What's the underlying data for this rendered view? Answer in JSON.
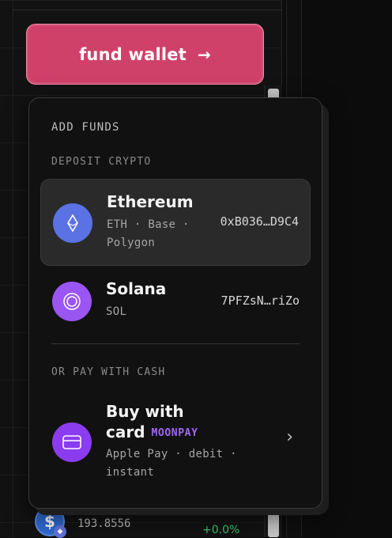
{
  "header": {
    "fund_button_label": "fund wallet",
    "fund_button_arrow": "→"
  },
  "background": {
    "coin_symbol": "$",
    "balance": "193.8556",
    "change": "+0.0%"
  },
  "popover": {
    "title": "ADD FUNDS",
    "deposit_section": "DEPOSIT CRYPTO",
    "options": [
      {
        "name": "Ethereum",
        "networks": "ETH · Base · Polygon",
        "networks_line1": "ETH · Base ·",
        "networks_line2": "Polygon",
        "address": "0xB036…D9C4",
        "icon": "ethereum-icon",
        "color": "#5b72e4"
      },
      {
        "name": "Solana",
        "networks": "SOL",
        "address": "7PFZsN…riZo",
        "icon": "solana-icon",
        "color": "#9a55f3"
      }
    ],
    "cash_section": "OR PAY WITH CASH",
    "cash_option": {
      "name_line1": "Buy with",
      "name_line2": "card",
      "provider": "MOONPAY",
      "methods_line1": "Apple Pay · debit ·",
      "methods_line2": "instant",
      "icon": "credit-card-icon",
      "color": "#8b3cf0"
    }
  }
}
